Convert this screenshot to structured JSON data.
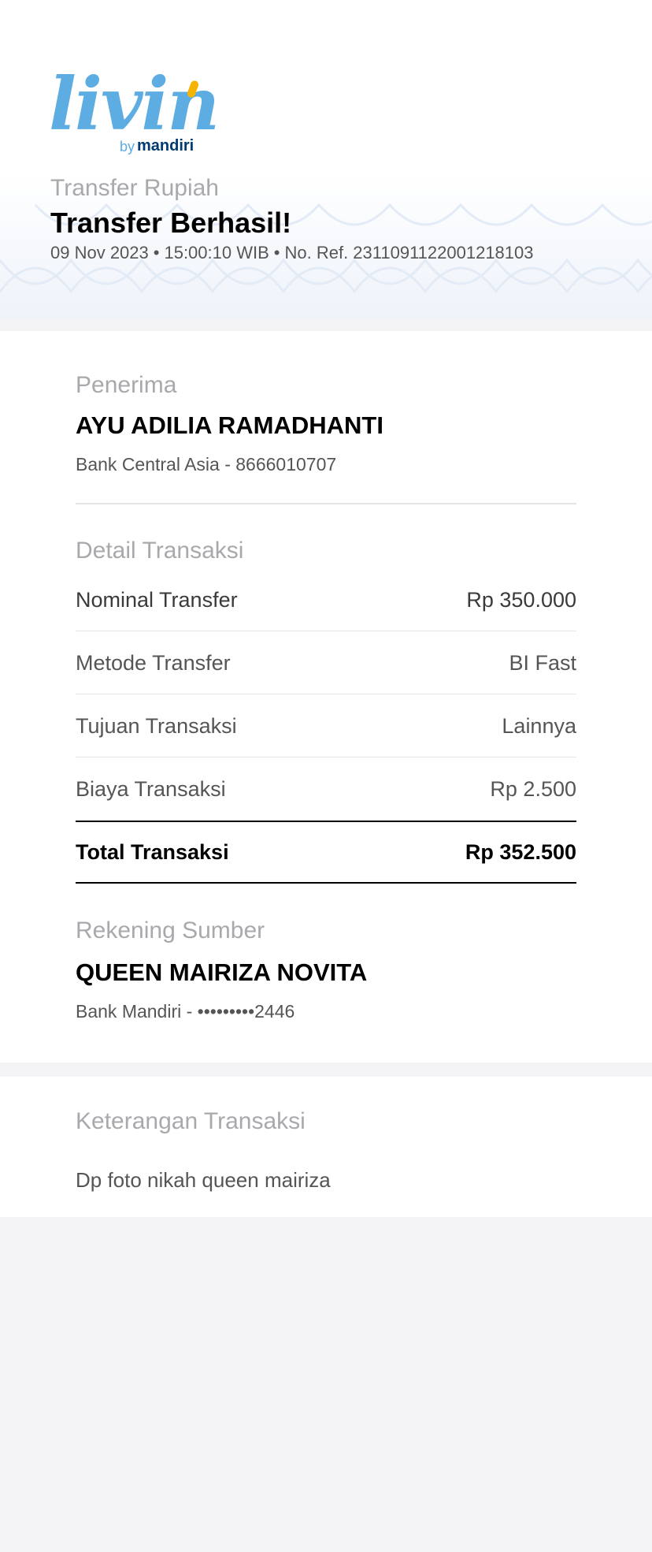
{
  "brand": {
    "logo_word": "livin",
    "logo_by": "by",
    "logo_name": "mandiri",
    "colors": {
      "primary": "#5dade2",
      "accent": "#f5b400",
      "dark": "#003a70"
    }
  },
  "header": {
    "subtitle": "Transfer Rupiah",
    "title": "Transfer Berhasil!",
    "date": "09 Nov 2023",
    "time": "15:00:10 WIB",
    "reference": "No. Ref. 2311091122001218103",
    "separator": "•"
  },
  "recipient": {
    "label": "Penerima",
    "name": "AYU ADILIA RAMADHANTI",
    "account": "Bank Central Asia - 8666010707"
  },
  "details": {
    "label": "Detail Transaksi",
    "rows": [
      {
        "key": "Nominal Transfer",
        "value": "Rp 350.000"
      },
      {
        "key": "Metode Transfer",
        "value": "BI Fast"
      },
      {
        "key": "Tujuan Transaksi",
        "value": "Lainnya"
      },
      {
        "key": "Biaya Transaksi",
        "value": "Rp 2.500"
      }
    ],
    "total": {
      "key": "Total Transaksi",
      "value": "Rp 352.500"
    }
  },
  "source": {
    "label": "Rekening Sumber",
    "name": "QUEEN MAIRIZA NOVITA",
    "account": "Bank Mandiri - •••••••••2446"
  },
  "note": {
    "label": "Keterangan Transaksi",
    "text": "Dp foto nikah queen mairiza"
  }
}
